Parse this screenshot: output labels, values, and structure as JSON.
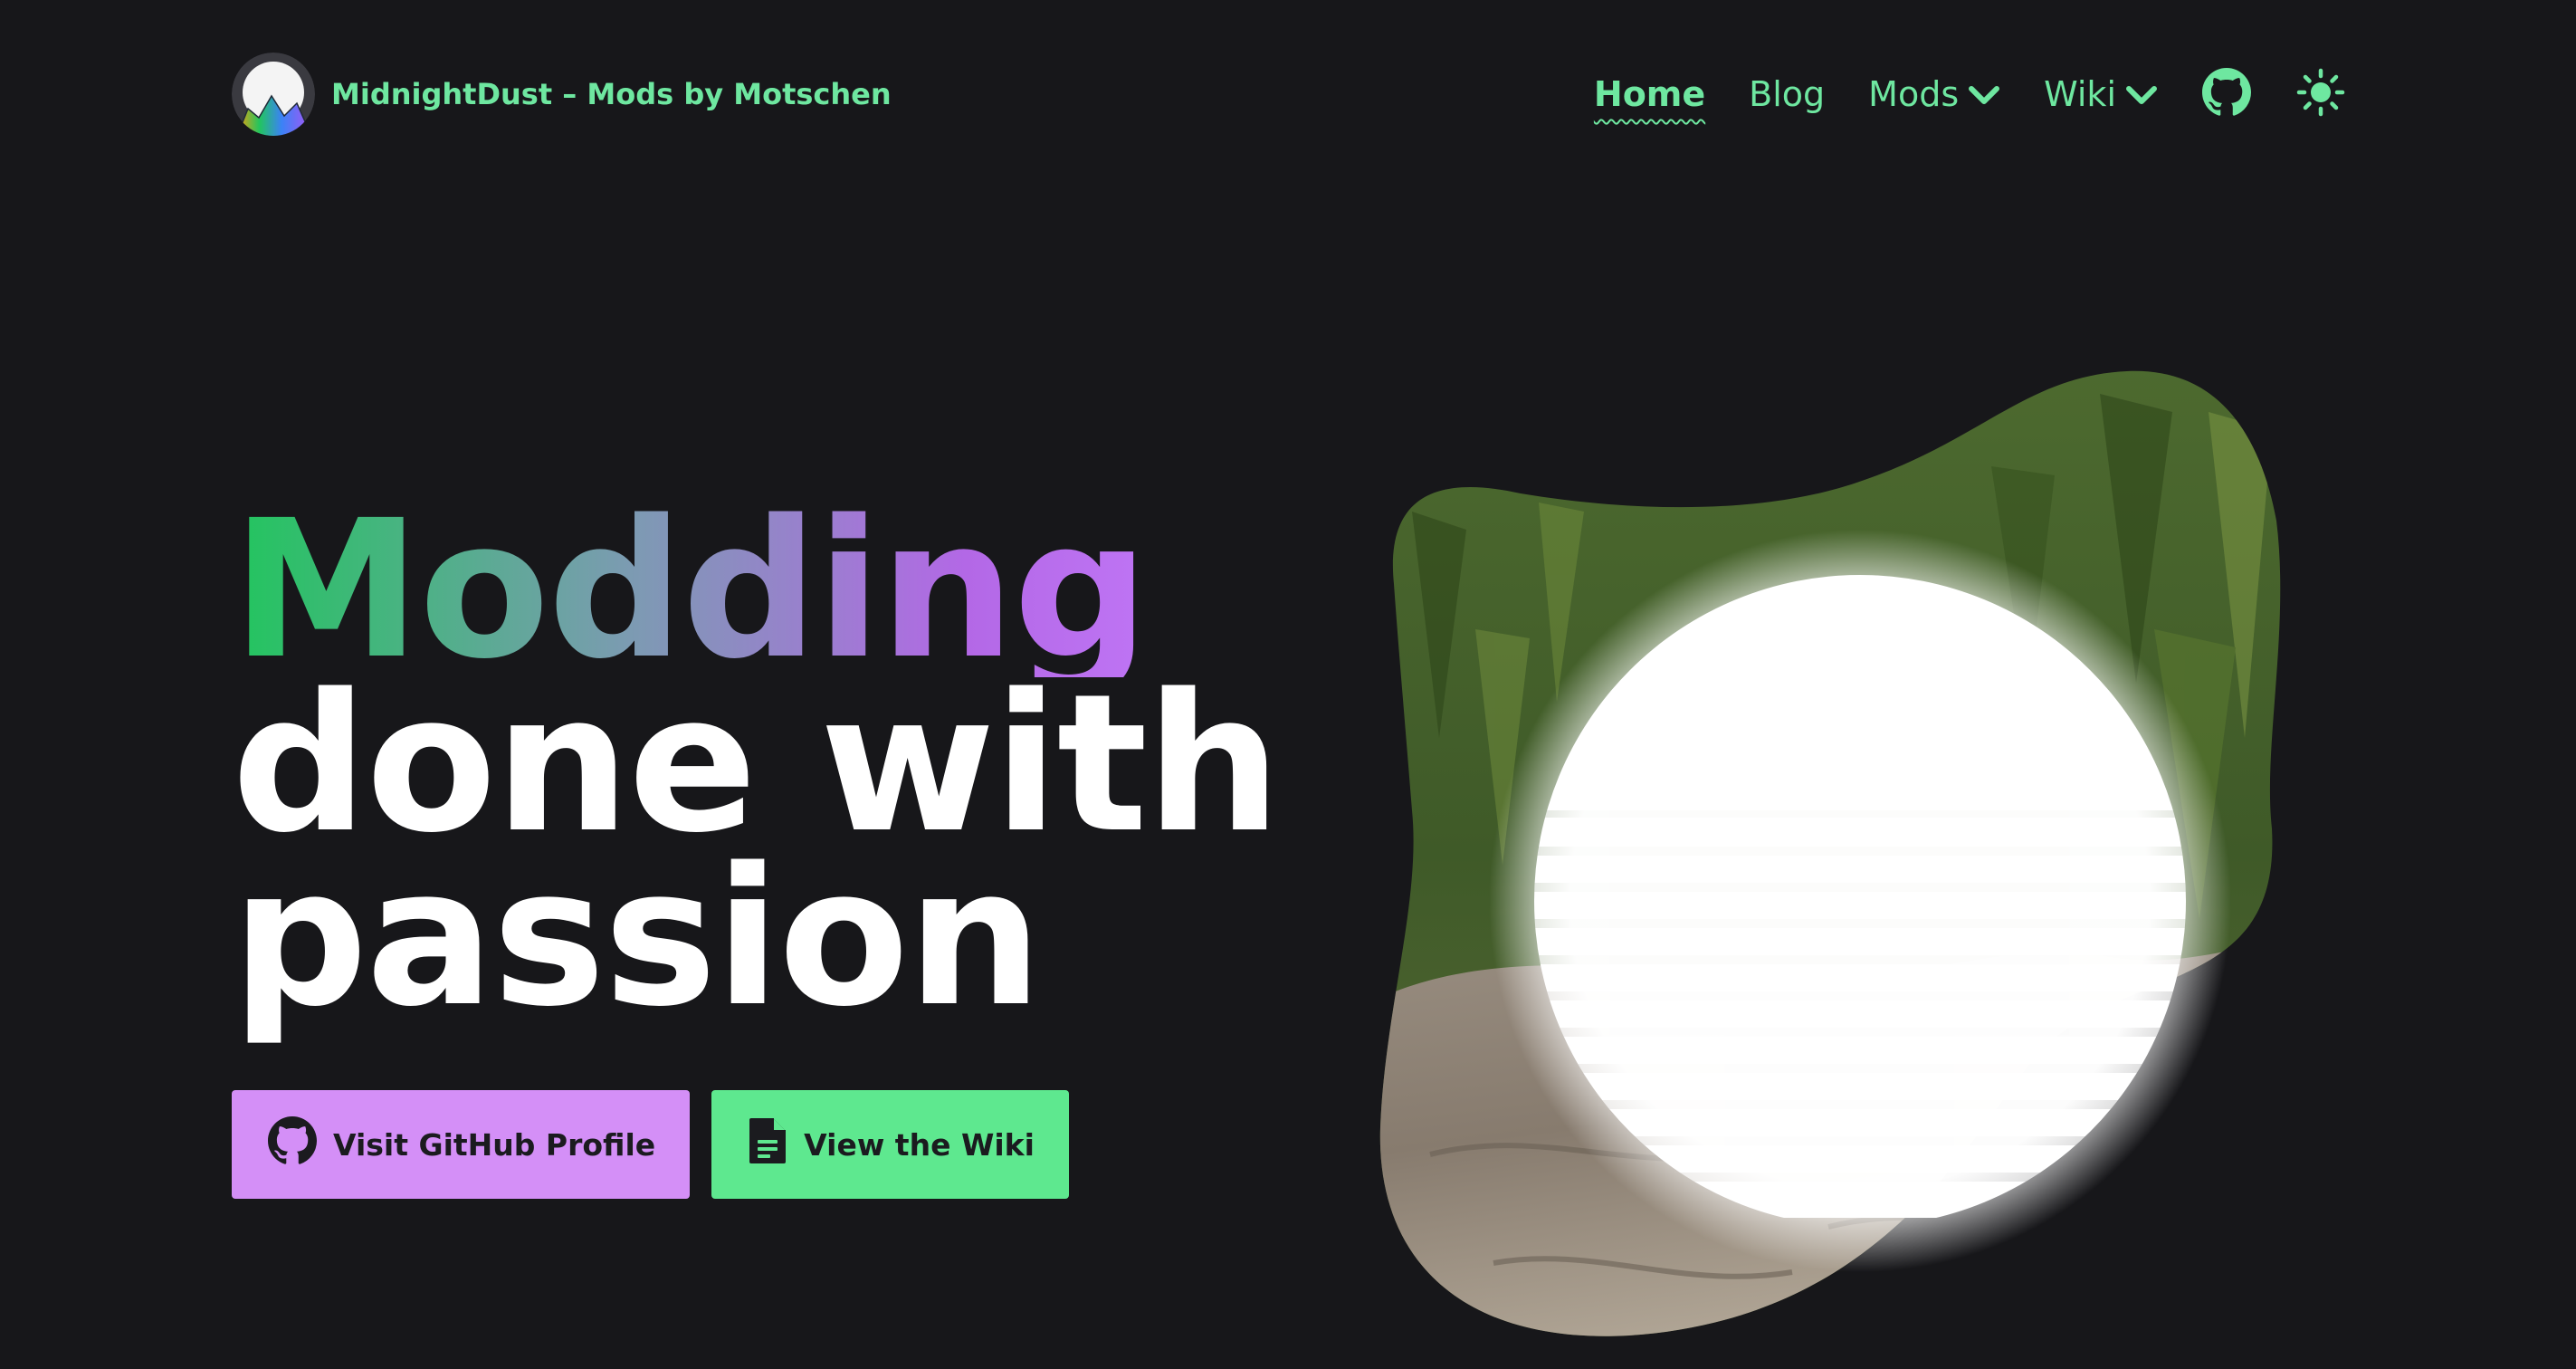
{
  "brand": {
    "title": "MidnightDust – Mods by Motschen",
    "logo_icon": "midnightdust-logo-icon"
  },
  "nav": {
    "items": [
      {
        "label": "Home",
        "active": true
      },
      {
        "label": "Blog",
        "active": false
      },
      {
        "label": "Mods",
        "dropdown": true
      },
      {
        "label": "Wiki",
        "dropdown": true
      }
    ],
    "github_icon": "github-icon",
    "theme_toggle_icon": "sun-icon"
  },
  "hero": {
    "title_highlight": "Modding",
    "title_line2": "done with",
    "title_line3": "passion",
    "buttons": {
      "github_label": "Visit GitHub Profile",
      "wiki_label": "View the Wiki"
    }
  },
  "colors": {
    "background": "#17171a",
    "accent_green": "#6ee7a0",
    "button_purple": "#d48ff7",
    "button_green": "#5ee88f",
    "gradient": [
      "#22c55e",
      "#7c9bb2",
      "#b368e6",
      "#c77dff"
    ]
  }
}
